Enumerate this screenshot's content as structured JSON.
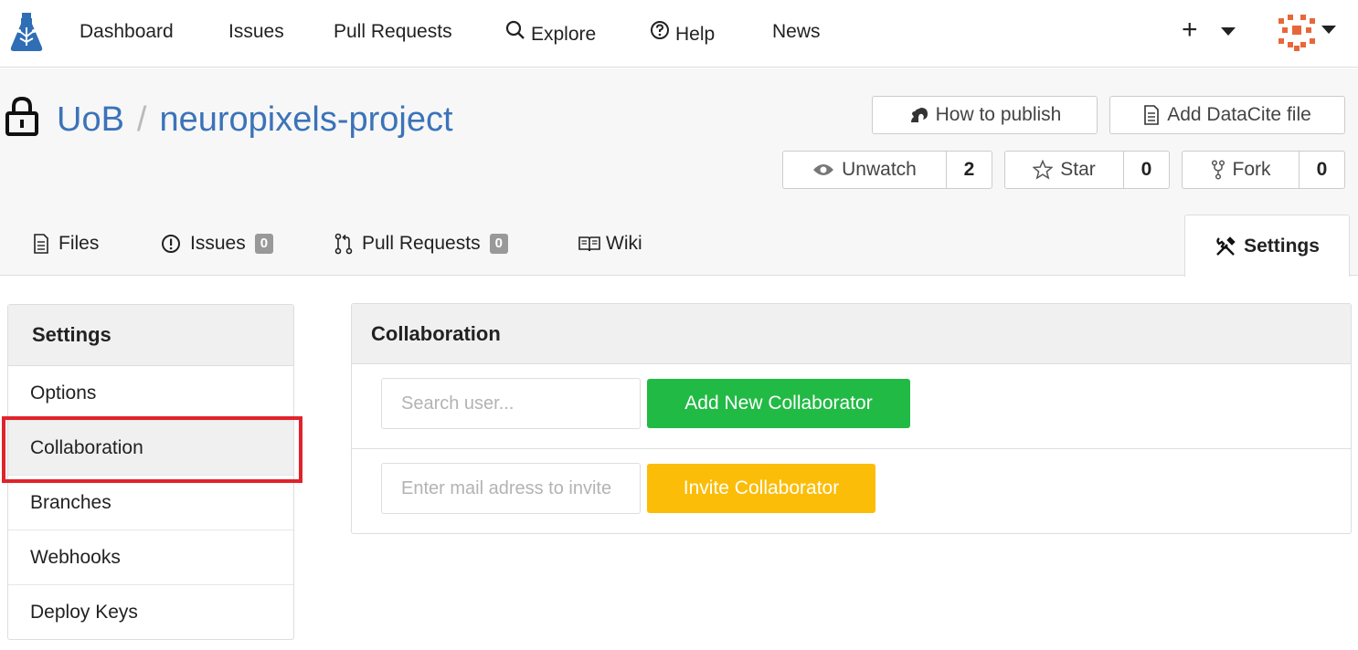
{
  "colors": {
    "link": "#3b73b9",
    "add_button": "#21ba45",
    "invite_button": "#fbbd08",
    "highlight": "#e0232a"
  },
  "topnav": {
    "items": [
      {
        "label": "Dashboard"
      },
      {
        "label": "Issues"
      },
      {
        "label": "Pull Requests"
      },
      {
        "label": "Explore",
        "icon": "search-icon"
      },
      {
        "label": "Help",
        "icon": "help-icon"
      },
      {
        "label": "News"
      }
    ],
    "plus": "+"
  },
  "repo": {
    "owner": "UoB",
    "separator": "/",
    "name": "neuropixels-project"
  },
  "actions": {
    "how_to_publish": "How to publish",
    "add_datacite": "Add DataCite file",
    "unwatch": "Unwatch",
    "unwatch_count": "2",
    "star": "Star",
    "star_count": "0",
    "fork": "Fork",
    "fork_count": "0"
  },
  "tabs": {
    "files": "Files",
    "issues": "Issues",
    "issues_count": "0",
    "pulls": "Pull Requests",
    "pulls_count": "0",
    "wiki": "Wiki",
    "settings": "Settings"
  },
  "sidebar": {
    "title": "Settings",
    "items": [
      {
        "label": "Options"
      },
      {
        "label": "Collaboration"
      },
      {
        "label": "Branches"
      },
      {
        "label": "Webhooks"
      },
      {
        "label": "Deploy Keys"
      }
    ]
  },
  "collaboration": {
    "title": "Collaboration",
    "search_placeholder": "Search user...",
    "add_button": "Add New Collaborator",
    "invite_placeholder": "Enter mail adress to invite",
    "invite_button": "Invite Collaborator"
  }
}
